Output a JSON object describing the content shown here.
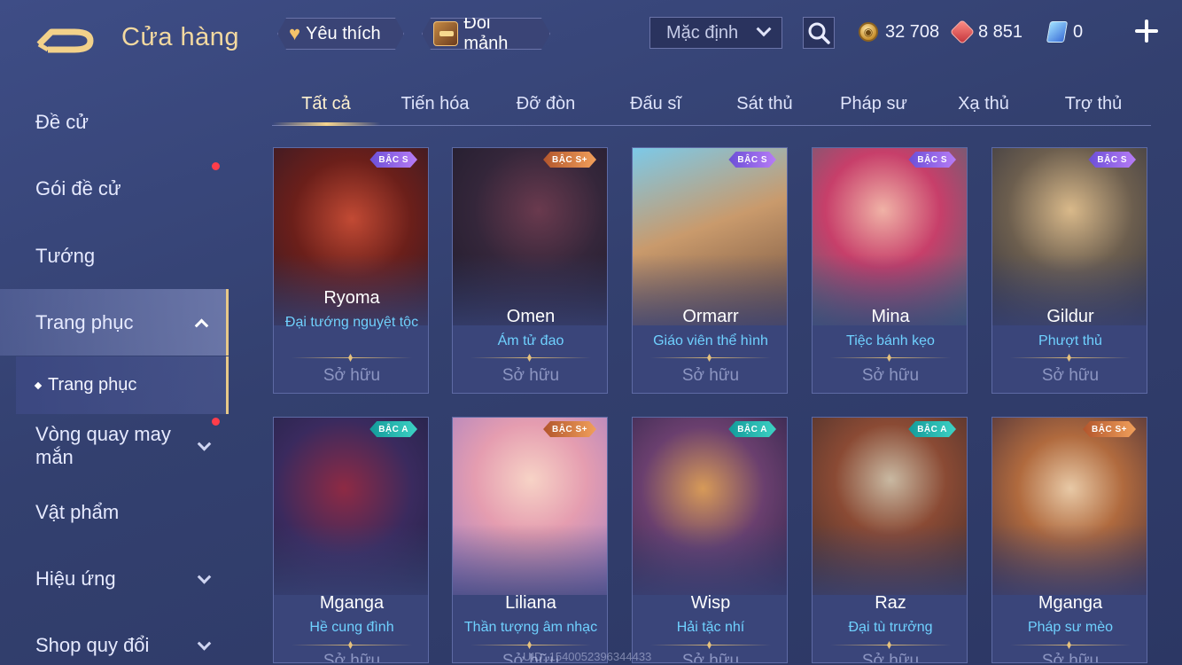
{
  "header": {
    "title": "Cửa hàng",
    "favorites_label": "Yêu thích",
    "exchange_label": "Đổi mảnh",
    "sort_value": "Mặc định",
    "currencies": [
      {
        "name": "gold",
        "value": "32 708"
      },
      {
        "name": "ruby",
        "value": "8 851"
      },
      {
        "name": "voucher",
        "value": "0"
      }
    ]
  },
  "sidebar": {
    "items": [
      {
        "label": "Đề cử"
      },
      {
        "label": "Gói đề cử"
      },
      {
        "label": "Tướng"
      },
      {
        "label": "Trang phục"
      },
      {
        "label": "Vòng quay may mắn"
      },
      {
        "label": "Vật phẩm"
      },
      {
        "label": "Hiệu ứng"
      },
      {
        "label": "Shop quy đổi"
      }
    ],
    "sub_item": "Trang phục"
  },
  "tabs": [
    "Tất cả",
    "Tiến hóa",
    "Đỡ đòn",
    "Đấu sĩ",
    "Sát thủ",
    "Pháp sư",
    "Xạ thủ",
    "Trợ thủ"
  ],
  "cards": [
    {
      "hero": "Ryoma",
      "skin": "Đại tướng nguyệt tộc",
      "rank": "BẬC S",
      "owned": "Sở hữu"
    },
    {
      "hero": "Omen",
      "skin": "Ám tử đao",
      "rank": "BẬC S+",
      "owned": "Sở hữu"
    },
    {
      "hero": "Ormarr",
      "skin": "Giáo viên thể hình",
      "rank": "BẬC S",
      "owned": "Sở hữu"
    },
    {
      "hero": "Mina",
      "skin": "Tiệc bánh kẹo",
      "rank": "BẬC S",
      "owned": "Sở hữu"
    },
    {
      "hero": "Gildur",
      "skin": "Phượt thủ",
      "rank": "BẬC S",
      "owned": "Sở hữu"
    },
    {
      "hero": "Mganga",
      "skin": "Hề cung đình",
      "rank": "BẬC A",
      "owned": "Sở hữu"
    },
    {
      "hero": "Liliana",
      "skin": "Thần tượng âm nhạc",
      "rank": "BẬC S+",
      "owned": "Sở hữu"
    },
    {
      "hero": "Wisp",
      "skin": "Hải tặc nhí",
      "rank": "BẬC A",
      "owned": "Sở hữu"
    },
    {
      "hero": "Raz",
      "skin": "Đại tù trưởng",
      "rank": "BẬC A",
      "owned": "Sở hữu"
    },
    {
      "hero": "Mganga",
      "skin": "Pháp sư mèo",
      "rank": "BẬC S+",
      "owned": "Sở hữu"
    }
  ],
  "uid_text": "UID: 1540052396344433"
}
